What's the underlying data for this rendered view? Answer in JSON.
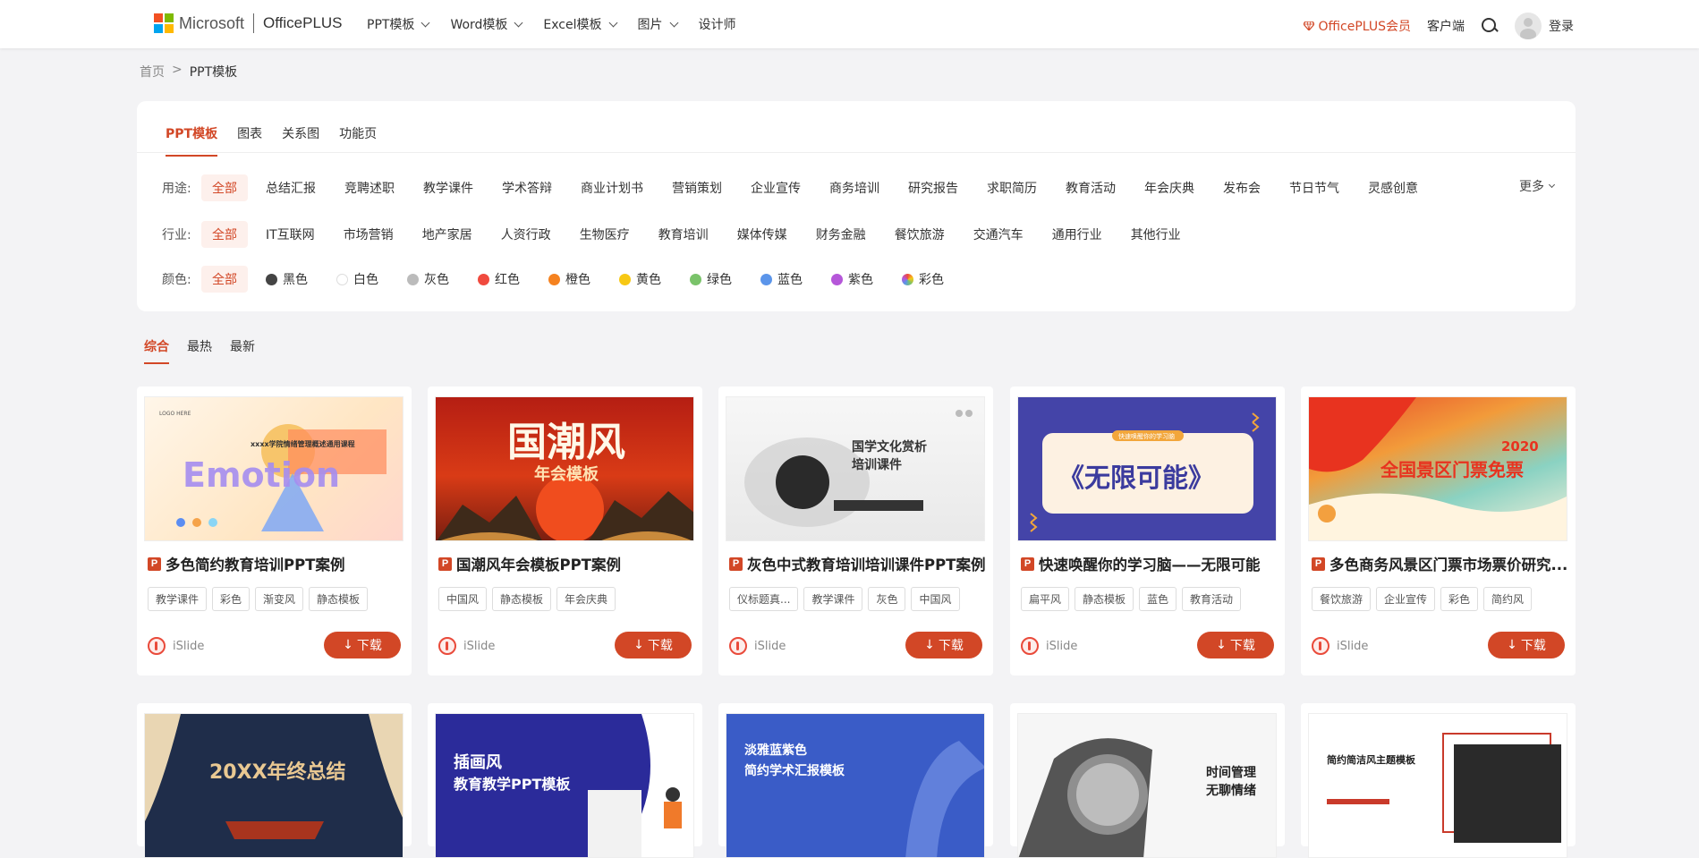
{
  "brand": {
    "ms": "Microsoft",
    "op": "OfficePLUS"
  },
  "nav": [
    {
      "label": "PPT模板"
    },
    {
      "label": "Word模板"
    },
    {
      "label": "Excel模板"
    },
    {
      "label": "图片"
    },
    {
      "label": "设计师"
    }
  ],
  "header_right": {
    "vip": "OfficePLUS会员",
    "client": "客户端",
    "login": "登录"
  },
  "breadcrumb": {
    "home": "首页",
    "sep": ">",
    "current": "PPT模板"
  },
  "tabs": [
    "PPT模板",
    "图表",
    "关系图",
    "功能页"
  ],
  "filters": {
    "usage_label": "用途:",
    "usage": [
      "全部",
      "总结汇报",
      "竞聘述职",
      "教学课件",
      "学术答辩",
      "商业计划书",
      "营销策划",
      "企业宣传",
      "商务培训",
      "研究报告",
      "求职简历",
      "教育活动",
      "年会庆典",
      "发布会",
      "节日节气",
      "灵感创意"
    ],
    "more": "更多",
    "industry_label": "行业:",
    "industry": [
      "全部",
      "IT互联网",
      "市场营销",
      "地产家居",
      "人资行政",
      "生物医疗",
      "教育培训",
      "媒体传媒",
      "财务金融",
      "餐饮旅游",
      "交通汽车",
      "通用行业",
      "其他行业"
    ],
    "color_label": "颜色:",
    "colors": [
      {
        "label": "全部",
        "color": ""
      },
      {
        "label": "黑色",
        "color": "#444444"
      },
      {
        "label": "白色",
        "color": "#ffffff"
      },
      {
        "label": "灰色",
        "color": "#bbbbbb"
      },
      {
        "label": "红色",
        "color": "#f04a3e"
      },
      {
        "label": "橙色",
        "color": "#f5821f"
      },
      {
        "label": "黄色",
        "color": "#f7c814"
      },
      {
        "label": "绿色",
        "color": "#7ac36a"
      },
      {
        "label": "蓝色",
        "color": "#5b95ea"
      },
      {
        "label": "紫色",
        "color": "#b557d9"
      },
      {
        "label": "彩色",
        "color": "conic"
      }
    ]
  },
  "sort": [
    "综合",
    "最热",
    "最新"
  ],
  "cards": [
    {
      "title": "多色简约教育培训PPT案例",
      "tags": [
        "教学课件",
        "彩色",
        "渐变风",
        "静态模板"
      ],
      "author": "iSlide",
      "download": "下载",
      "thumb_text": "Emotion",
      "thumb_sub": "xxxx学院情绪管理概述通用课程",
      "thumb_logo": "LOGO HERE"
    },
    {
      "title": "国潮风年会模板PPT案例",
      "tags": [
        "中国风",
        "静态模板",
        "年会庆典"
      ],
      "author": "iSlide",
      "download": "下载",
      "thumb_text": "国潮风",
      "thumb_sub": "年会模板"
    },
    {
      "title": "灰色中式教育培训培训课件PPT案例",
      "tags": [
        "仪标题真...",
        "教学课件",
        "灰色",
        "中国风"
      ],
      "author": "iSlide",
      "download": "下载",
      "thumb_text": "国学文化赏析",
      "thumb_sub": "培训课件"
    },
    {
      "title": "快速唤醒你的学习脑——无限可能",
      "tags": [
        "扁平风",
        "静态模板",
        "蓝色",
        "教育活动"
      ],
      "author": "iSlide",
      "download": "下载",
      "thumb_text": "《无限可能》",
      "thumb_sub": "快速唤醒你的学习脑"
    },
    {
      "title": "多色商务风景区门票市场票价研究...",
      "tags": [
        "餐饮旅游",
        "企业宣传",
        "彩色",
        "简约风"
      ],
      "author": "iSlide",
      "download": "下载",
      "thumb_text": "全国景区门票免票",
      "thumb_sub": "2020"
    },
    {
      "thumb_text": "20XX年终总结"
    },
    {
      "thumb_text": "插画风",
      "thumb_sub": "教育教学PPT模板"
    },
    {
      "thumb_text": "淡雅蓝紫色",
      "thumb_sub": "简约学术汇报模板"
    },
    {
      "thumb_text": "时间管理",
      "thumb_sub": "无聊情绪"
    },
    {
      "thumb_text": "简约简洁风主题模板"
    }
  ]
}
